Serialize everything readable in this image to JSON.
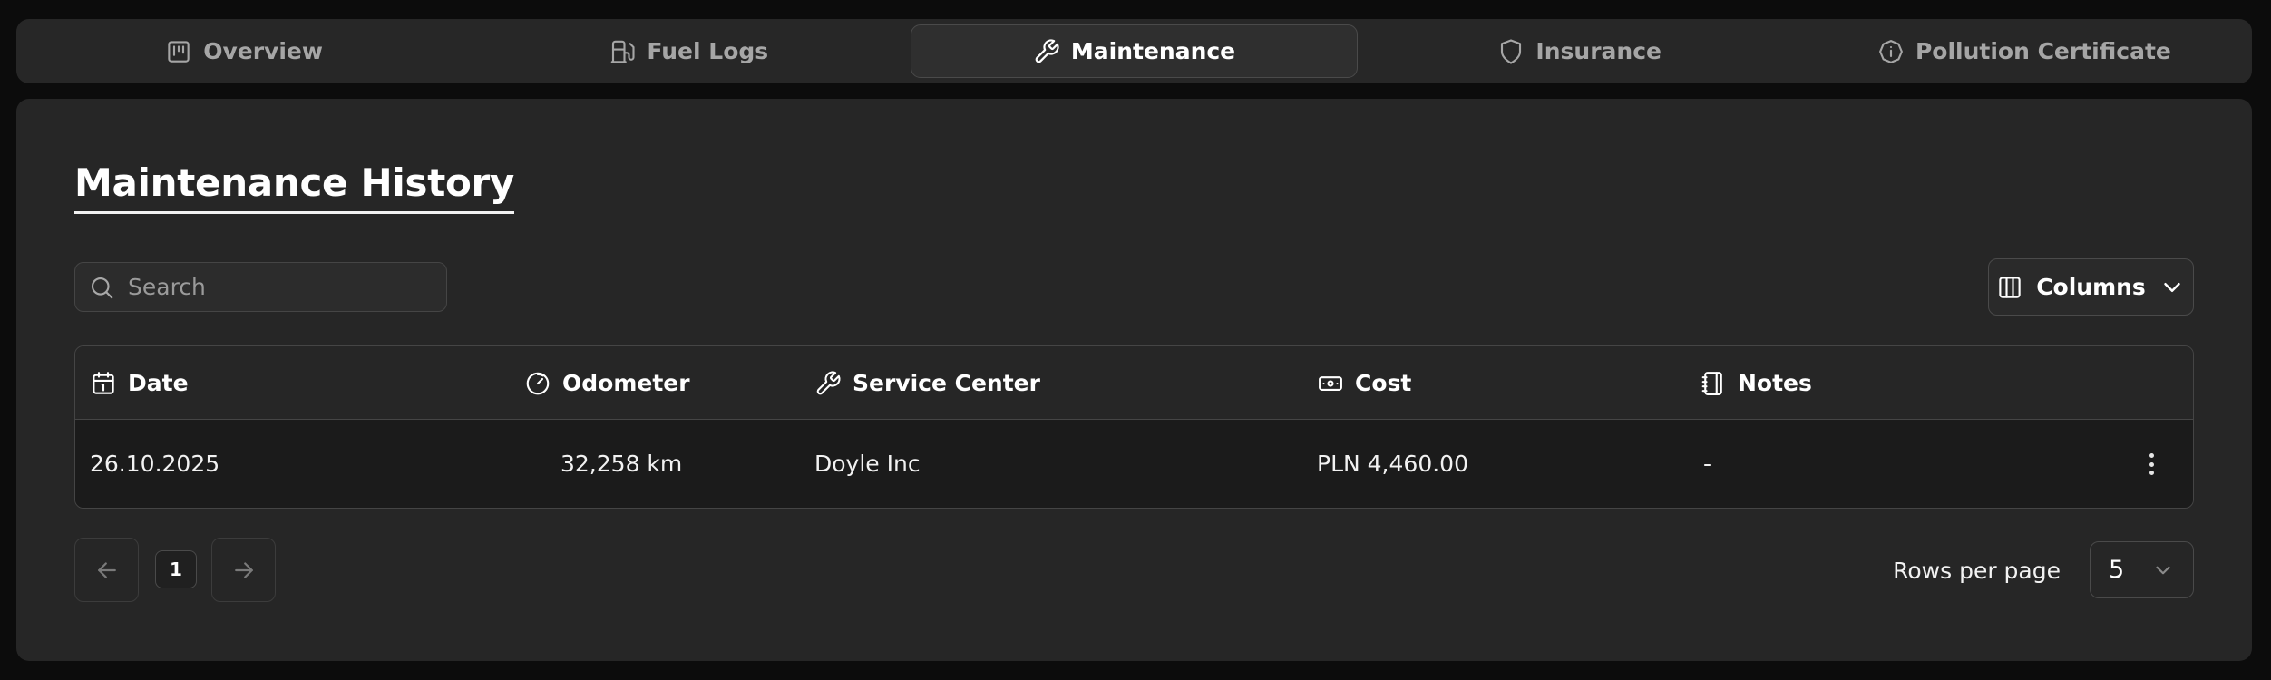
{
  "tabs": [
    {
      "label": "Overview",
      "icon": "overview-icon",
      "active": false
    },
    {
      "label": "Fuel Logs",
      "icon": "fuel-pump-icon",
      "active": false
    },
    {
      "label": "Maintenance",
      "icon": "wrench-icon",
      "active": true
    },
    {
      "label": "Insurance",
      "icon": "shield-icon",
      "active": false
    },
    {
      "label": "Pollution Certificate",
      "icon": "info-octagon-icon",
      "active": false
    }
  ],
  "page": {
    "title": "Maintenance History"
  },
  "search": {
    "placeholder": "Search",
    "value": ""
  },
  "toolbar": {
    "columns_label": "Columns"
  },
  "table": {
    "columns": [
      {
        "label": "Date",
        "icon": "calendar-icon"
      },
      {
        "label": "Odometer",
        "icon": "gauge-icon"
      },
      {
        "label": "Service Center",
        "icon": "wrench-icon"
      },
      {
        "label": "Cost",
        "icon": "banknote-icon"
      },
      {
        "label": "Notes",
        "icon": "notebook-icon"
      }
    ],
    "rows": [
      {
        "date": "26.10.2025",
        "odometer": "32,258 km",
        "service_center": "Doyle Inc",
        "cost": "PLN 4,460.00",
        "notes": "-"
      }
    ]
  },
  "pagination": {
    "current_page": "1",
    "rows_per_page_label": "Rows per page",
    "rows_per_page": "5"
  },
  "colors": {
    "background": "#0c0c0c",
    "surface": "#262626",
    "row": "#1b1b1b",
    "border": "#454545",
    "text": "#f2f2f2",
    "muted": "#a6a6a6"
  }
}
